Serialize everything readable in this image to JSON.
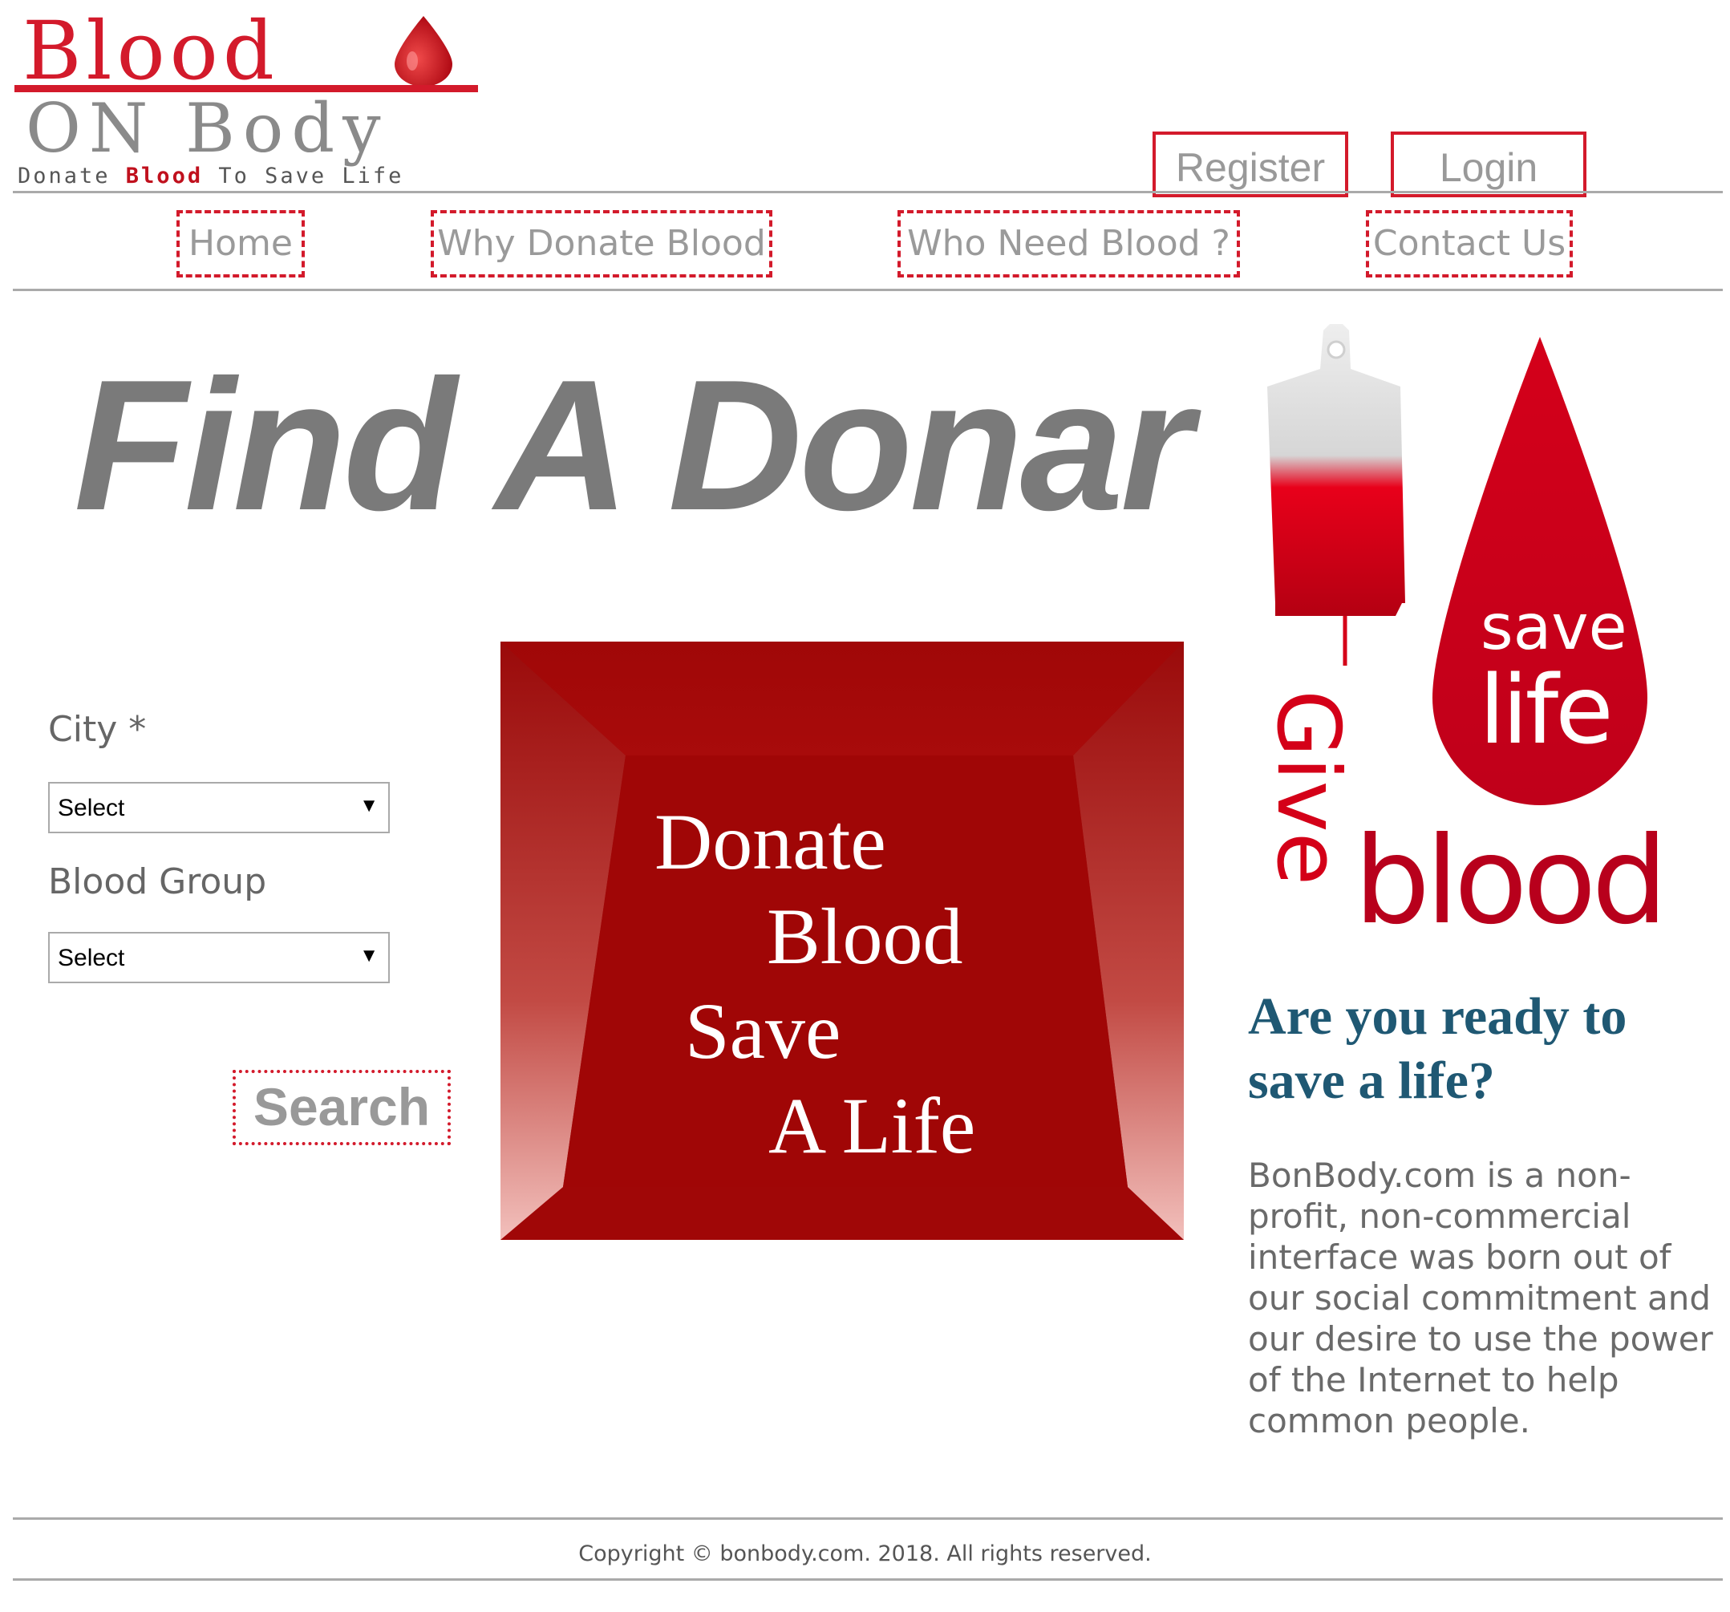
{
  "logo": {
    "title": "Blood",
    "subtitle": "ON Body",
    "tagline_pre": "Donate ",
    "tagline_mid": "Blood",
    "tagline_post": " To Save Life"
  },
  "auth": {
    "register_label": "Register",
    "login_label": "Login"
  },
  "nav": {
    "home": "Home",
    "why": "Why Donate Blood",
    "who": "Who Need Blood ?",
    "contact": "Contact Us"
  },
  "hero": {
    "title": "Find A Donar"
  },
  "form": {
    "city_label": "City *",
    "city_value": "Select",
    "blood_label": "Blood Group",
    "blood_value": "Select",
    "search_label": "Search"
  },
  "banner": {
    "line1": "Donate",
    "line2": "Blood",
    "line3": "Save",
    "line4": "A Life"
  },
  "promo": {
    "give": "Give",
    "save": "save",
    "life": "life",
    "blood": "blood"
  },
  "side": {
    "heading": "Are you ready to save a life?",
    "about": "BonBody.com is a non-profit, non-commercial interface was born out of our social commitment and our desire to use the power of the Internet to help common people."
  },
  "footer": {
    "copyright": "Copyright © bonbody.com. 2018. All rights reserved."
  },
  "colors": {
    "brand_red": "#d31a2b",
    "heading_blue": "#1f5873",
    "text_gray": "#6a6a6a"
  }
}
